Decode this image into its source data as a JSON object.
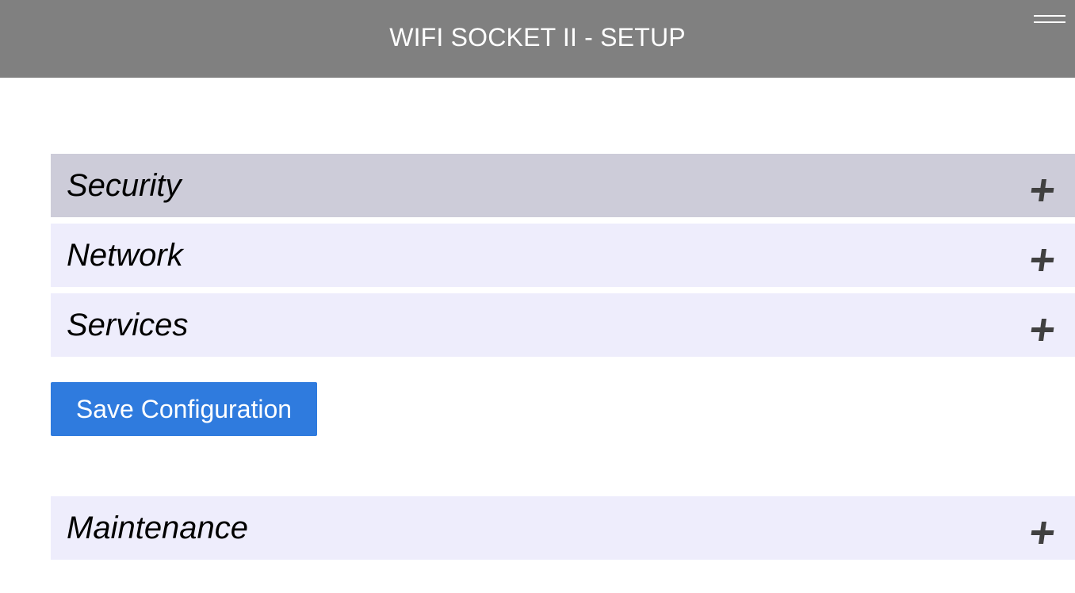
{
  "header": {
    "title": "WIFI SOCKET II - SETUP",
    "menu_icon": "hamburger-menu-icon",
    "background_color": "#808080"
  },
  "sections": [
    {
      "label": "Security",
      "icon": "plus-icon",
      "state": "highlighted"
    },
    {
      "label": "Network",
      "icon": "plus-icon",
      "state": "collapsed"
    },
    {
      "label": "Services",
      "icon": "plus-icon",
      "state": "collapsed"
    }
  ],
  "actions": {
    "save_label": "Save Configuration",
    "save_color": "#2f7bde"
  },
  "maintenance": {
    "label": "Maintenance",
    "icon": "plus-icon",
    "state": "collapsed"
  },
  "colors": {
    "panel_bg": "#eeedfc",
    "panel_active_bg": "#cdccd9",
    "plus_icon": "#404040"
  }
}
